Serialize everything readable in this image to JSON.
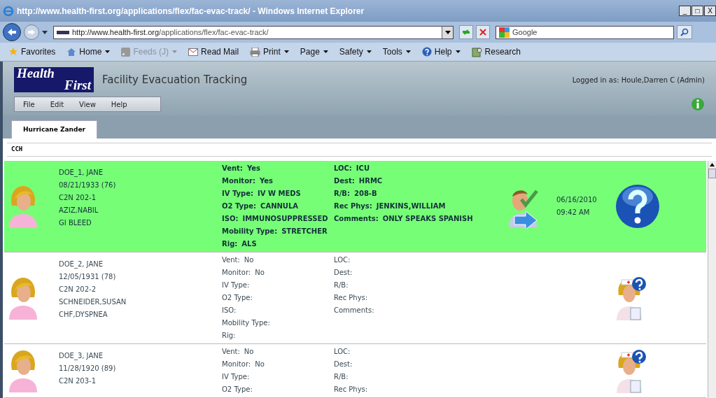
{
  "window": {
    "title": "http://www.health-first.org/applications/flex/fac-evac-track/ - Windows Internet Explorer",
    "controls": [
      "_",
      "□",
      "X"
    ]
  },
  "address_bar": {
    "url_host": "http://www.health-first.org",
    "url_path": "/applications/flex/fac-evac-track/",
    "search_placeholder": "Google"
  },
  "command_bar": [
    {
      "label": "Favorites",
      "kind": "star",
      "dropdown": false,
      "disabled": false
    },
    {
      "label": "Home",
      "kind": "home",
      "dropdown": true,
      "disabled": false
    },
    {
      "label": "Feeds (J)",
      "kind": "feed",
      "dropdown": true,
      "disabled": true
    },
    {
      "label": "Read Mail",
      "kind": "mail",
      "dropdown": false,
      "disabled": false
    },
    {
      "label": "Print",
      "kind": "print",
      "dropdown": true,
      "disabled": false
    },
    {
      "label": "Page",
      "kind": "plain",
      "dropdown": true,
      "disabled": false
    },
    {
      "label": "Safety",
      "kind": "plain",
      "dropdown": true,
      "disabled": false
    },
    {
      "label": "Tools",
      "kind": "plain",
      "dropdown": true,
      "disabled": false
    },
    {
      "label": "Help",
      "kind": "help",
      "dropdown": true,
      "disabled": false
    },
    {
      "label": "Research",
      "kind": "research",
      "dropdown": false,
      "disabled": false
    }
  ],
  "app": {
    "logo_top": "Health",
    "logo_bottom": "First",
    "title": "Facility Evacuation Tracking",
    "logged_in": "Logged in as: Houle,Darren C (Admin)",
    "menu": [
      "File",
      "Edit",
      "View",
      "Help"
    ]
  },
  "tabs": [
    {
      "label": "Hurricane Zander",
      "selected": true
    }
  ],
  "section": "CCH",
  "patients": [
    {
      "selected": true,
      "lines": [
        "DOE_1, JANE",
        "08/21/1933 (76)",
        "C2N 202-1",
        "AZIZ,NABIL",
        "GI BLEED"
      ],
      "fields_left": [
        {
          "label": "Vent:",
          "value": "Yes"
        },
        {
          "label": "Monitor:",
          "value": "Yes"
        },
        {
          "label": "IV Type:",
          "value": "IV W MEDS"
        },
        {
          "label": "O2 Type:",
          "value": "CANNULA"
        },
        {
          "label": "ISO:",
          "value": "IMMUNOSUPPRESSED"
        },
        {
          "label": "Mobility Type:",
          "value": "STRETCHER"
        },
        {
          "label": "Rig:",
          "value": "ALS"
        }
      ],
      "fields_right": [
        {
          "label": "LOC:",
          "value": "ICU"
        },
        {
          "label": "Dest:",
          "value": "HRMC"
        },
        {
          "label": "R/B:",
          "value": "208-B"
        },
        {
          "label": "Rec Phys:",
          "value": "JENKINS,WILLIAM"
        },
        {
          "label": "Comments:",
          "value": "ONLY SPEAKS SPANISH"
        }
      ],
      "kind": "transferred",
      "date": "06/16/2010",
      "time": "09:42 AM"
    },
    {
      "selected": false,
      "lines": [
        "DOE_2, JANE",
        "12/05/1931 (78)",
        "C2N 202-2",
        "SCHNEIDER,SUSAN",
        "CHF,DYSPNEA"
      ],
      "fields_left": [
        {
          "label": "Vent:",
          "value": "No"
        },
        {
          "label": "Monitor:",
          "value": "No"
        },
        {
          "label": "IV Type:"
        },
        {
          "label": "O2 Type:"
        },
        {
          "label": "ISO:"
        },
        {
          "label": "Mobility Type:"
        },
        {
          "label": "Rig:"
        }
      ],
      "fields_right": [
        {
          "label": "LOC:"
        },
        {
          "label": "Dest:"
        },
        {
          "label": "R/B:"
        },
        {
          "label": "Rec Phys:"
        },
        {
          "label": "Comments:"
        }
      ],
      "kind": "pending"
    },
    {
      "selected": false,
      "lines": [
        "DOE_3, JANE",
        "11/28/1920 (89)",
        "C2N 203-1"
      ],
      "fields_left": [
        {
          "label": "Vent:",
          "value": "No"
        },
        {
          "label": "Monitor:",
          "value": "No"
        },
        {
          "label": "IV Type:"
        },
        {
          "label": "O2 Type:"
        }
      ],
      "fields_right": [
        {
          "label": "LOC:"
        },
        {
          "label": "Dest:"
        },
        {
          "label": "R/B:"
        },
        {
          "label": "Rec Phys:"
        }
      ],
      "kind": "pending"
    }
  ]
}
